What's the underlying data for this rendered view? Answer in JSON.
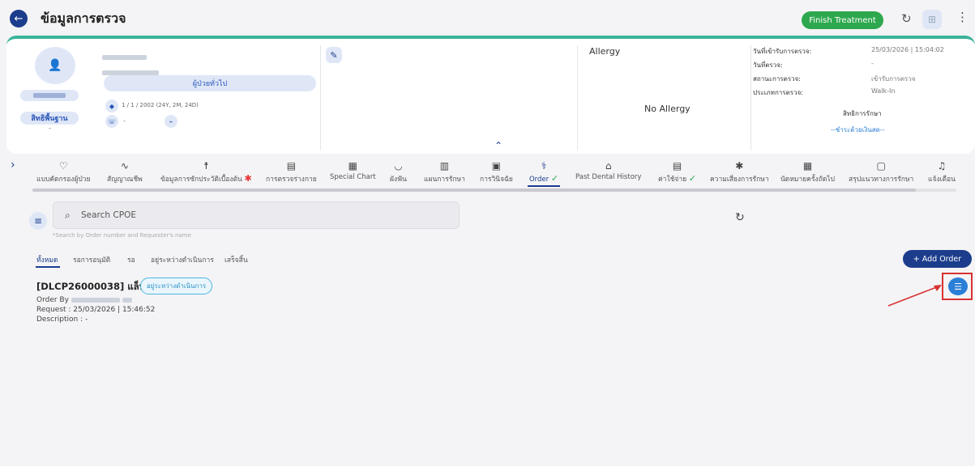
{
  "header": {
    "title": "ข้อมูลการตรวจ",
    "finish_label": "Finish Treatment",
    "refresh_icon": "refresh-icon",
    "more_icon": "kebab-icon"
  },
  "patient": {
    "group_label": "ผู้ป่วยทั่วไป",
    "rights_button": "สิทธิพื้นฐาน",
    "rights_sub": "-",
    "dob": "1 / 1 / 2002 (24Y, 2M, 24D)",
    "phone": "-",
    "allergy_label": "Allergy",
    "allergy_value": "No Allergy",
    "visit_info": [
      {
        "label": "วันที่เข้ารับการตรวจ:",
        "value": "25/03/2026 | 15:04:02"
      },
      {
        "label": "วันที่ตรวจ:",
        "value": "-"
      },
      {
        "label": "สถานะการตรวจ:",
        "value": "เข้ารับการตรวจ"
      },
      {
        "label": "ประเภทการตรวจ:",
        "value": "Walk-In"
      }
    ],
    "rights_title": "สิทธิการรักษา",
    "rights_value": "--ชำระด้วยเงินสด--"
  },
  "tabs": [
    {
      "label": "แบบคัดกรองผู้ป่วย",
      "icon": "stethoscope-icon",
      "glyph": "♡"
    },
    {
      "label": "สัญญาณชีพ",
      "icon": "vitals-icon",
      "glyph": "∿"
    },
    {
      "label": "ข้อมูลการซักประวัติเบื้องต้น",
      "icon": "person-icon",
      "glyph": "☨"
    },
    {
      "label": "การตรวจร่างกาย",
      "icon": "exam-icon",
      "glyph": "▤"
    },
    {
      "label": "Special Chart",
      "icon": "chart-icon",
      "glyph": "▦"
    },
    {
      "label": "ผังฟัน",
      "icon": "tooth-icon",
      "glyph": "◡"
    },
    {
      "label": "แผนการรักษา",
      "icon": "plan-icon",
      "glyph": "▥"
    },
    {
      "label": "การวินิจฉัย",
      "icon": "diagnosis-icon",
      "glyph": "▣"
    },
    {
      "label": "Order",
      "icon": "order-stethoscope-icon",
      "glyph": "⚕"
    },
    {
      "label": "Past Dental History",
      "icon": "history-icon",
      "glyph": "⌂"
    },
    {
      "label": "ค่าใช้จ่าย",
      "icon": "expense-icon",
      "glyph": "▤"
    },
    {
      "label": "ความเสี่ยงการรักษา",
      "icon": "asterisk-icon",
      "glyph": "✱"
    },
    {
      "label": "นัดหมายครั้งถัดไป",
      "icon": "calendar-icon",
      "glyph": "▦"
    },
    {
      "label": "สรุปแนวทางการรักษา",
      "icon": "summary-icon",
      "glyph": "▢"
    },
    {
      "label": "แจ้งเตือน",
      "icon": "bell-icon",
      "glyph": "♫"
    }
  ],
  "search": {
    "placeholder": "Search CPOE",
    "hint": "*Search by Order number and Requester's name"
  },
  "status_tabs": [
    "ทั้งหมด",
    "รอการอนุมัติ",
    "รอ",
    "อยู่ระหว่างดำเนินการ",
    "เสร็จสิ้น"
  ],
  "add_order_label": "+ Add Order",
  "order": {
    "title": "[DLCP26000038] แล็บเลือด",
    "status": "อยู่ระหว่างดำเนินการ",
    "order_by_label": "Order By",
    "request": "Request : 25/03/2026 | 15:46:52",
    "description": "Description : -"
  },
  "colors": {
    "primary": "#1c3d8c",
    "success": "#2ea84e",
    "accent_strip": "#39b39a",
    "highlight": "#d83333"
  }
}
